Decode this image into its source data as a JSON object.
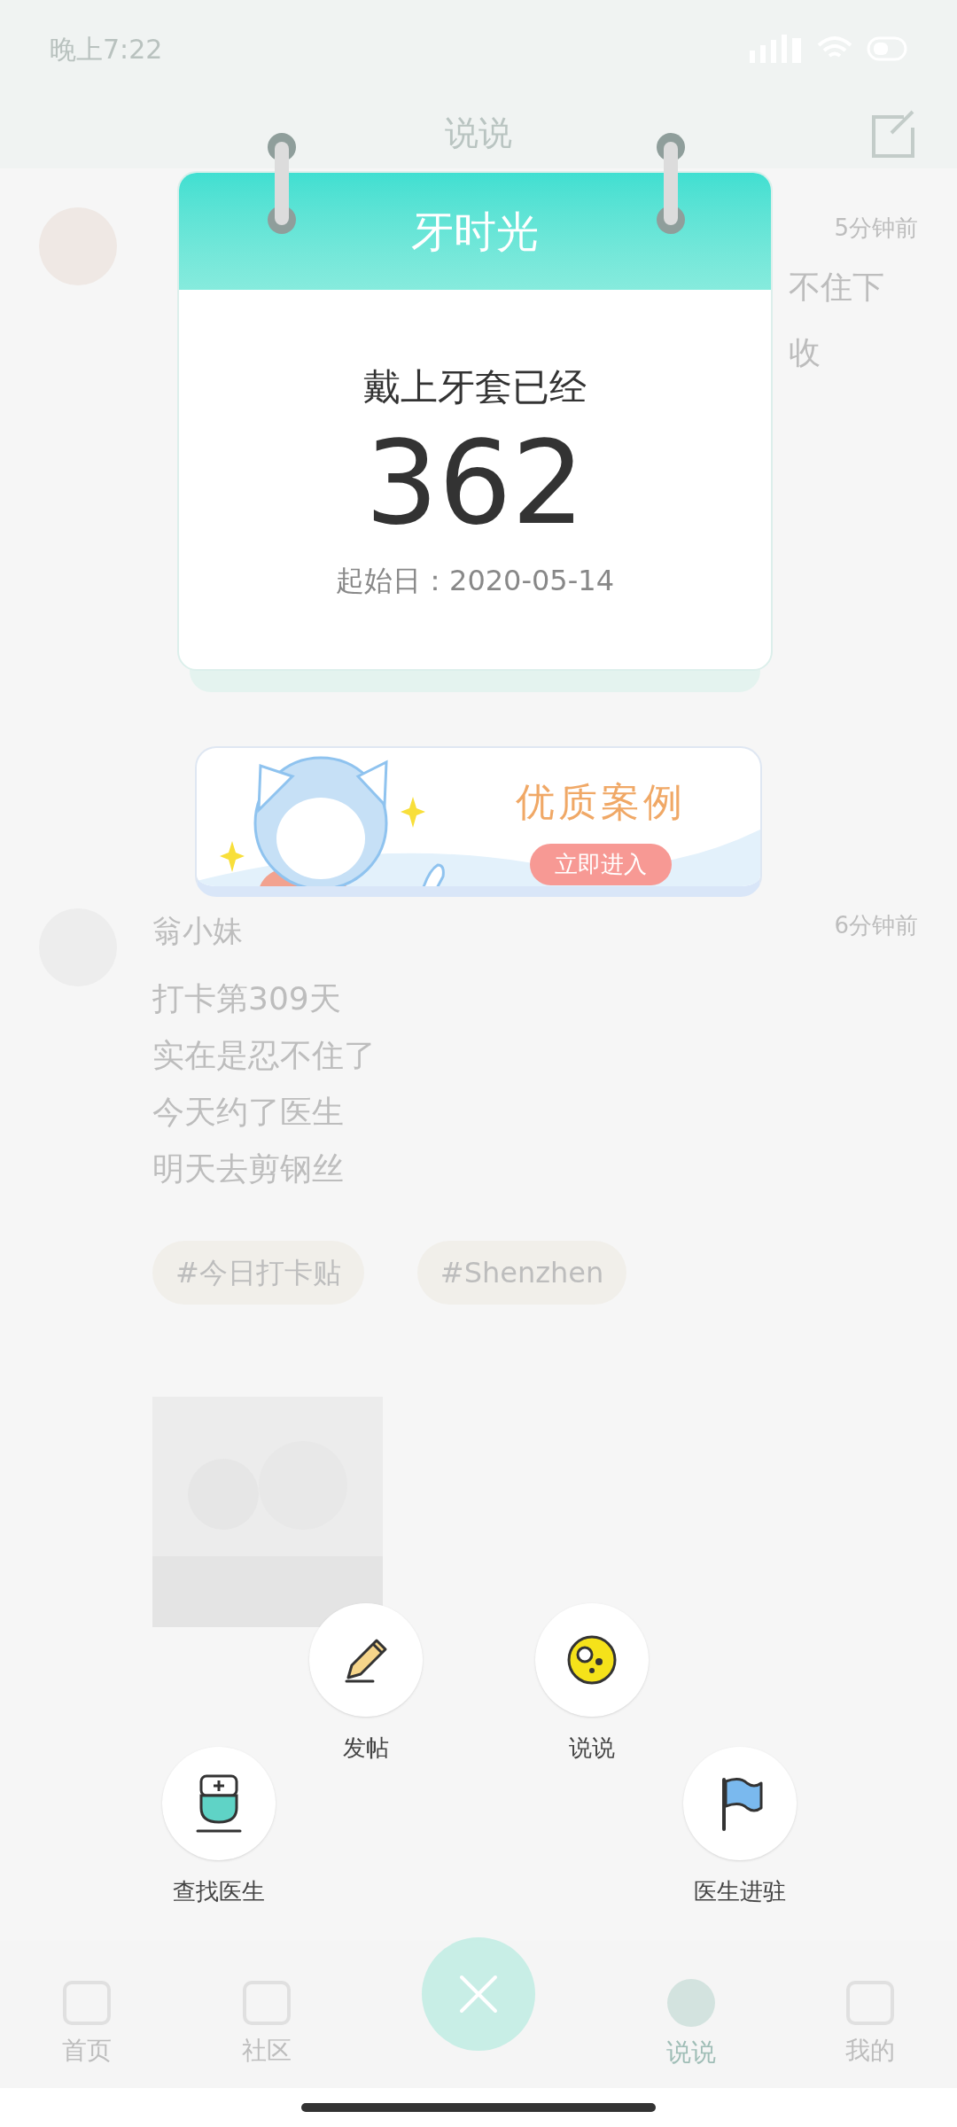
{
  "status_bar": {
    "time": "晚上7:22"
  },
  "background": {
    "header_title": "说说",
    "posts": [
      {
        "time": "5分钟前",
        "text_fragments": [
          "不住下",
          "收"
        ]
      },
      {
        "author": "翁小妹",
        "time": "6分钟前",
        "lines": [
          "打卡第309天",
          "实在是忍不住了",
          "今天约了医生",
          "明天去剪钢丝"
        ],
        "tags": [
          "#今日打卡贴",
          "#Shenzhen"
        ]
      }
    ],
    "nav": [
      {
        "label": "首页",
        "selected": false
      },
      {
        "label": "社区",
        "selected": false
      },
      {
        "label": "说说",
        "selected": true
      },
      {
        "label": "我的",
        "selected": false
      }
    ]
  },
  "calendar": {
    "title": "牙时光",
    "caption": "戴上牙套已经",
    "days": "362",
    "start_date": "起始日：2020-05-14"
  },
  "banner": {
    "title": "优质案例",
    "button": "立即进入"
  },
  "actions": [
    {
      "label": "发帖",
      "kind": "pencil"
    },
    {
      "label": "说说",
      "kind": "face"
    },
    {
      "label": "查找医生",
      "kind": "doctor"
    },
    {
      "label": "医生进驻",
      "kind": "flag"
    }
  ]
}
